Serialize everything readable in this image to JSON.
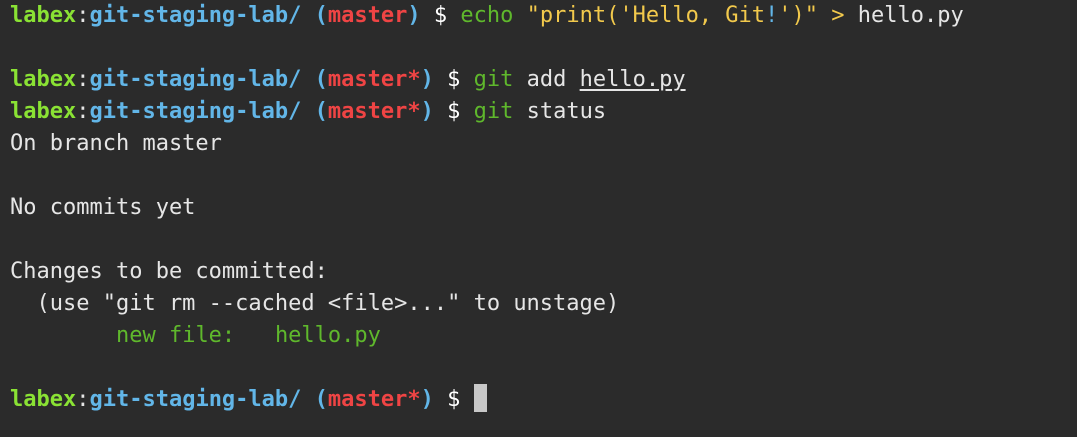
{
  "prompt": {
    "user": "labex",
    "sep": ":",
    "path": "git-staging-lab/",
    "open_paren": "(",
    "close_paren": ")",
    "dollar": "$"
  },
  "lines": {
    "l1": {
      "branch": "master",
      "cmd": "echo",
      "arg_start": "\"print('Hello, Git",
      "arg_bang": "!",
      "arg_end": "')\"",
      "redirect": ">",
      "target": "hello.py"
    },
    "l2": {
      "branch": "master*",
      "cmd": "git",
      "sub": "add",
      "file": "hello.py"
    },
    "l3": {
      "branch": "master*",
      "cmd": "git",
      "sub": "status"
    },
    "output": {
      "on_branch": "On branch master",
      "no_commits": "No commits yet",
      "changes_header": "Changes to be committed:",
      "hint": "  (use \"git rm --cached <file>...\" to unstage)",
      "staged_label": "new file:",
      "staged_file": "hello.py"
    },
    "l_last": {
      "branch": "master*"
    }
  },
  "colors": {
    "background": "#2b2b2b",
    "user": "#8ae234",
    "path": "#62b6e8",
    "branch": "#ef4444",
    "command": "#5fb82c",
    "string": "#f2c94c"
  }
}
